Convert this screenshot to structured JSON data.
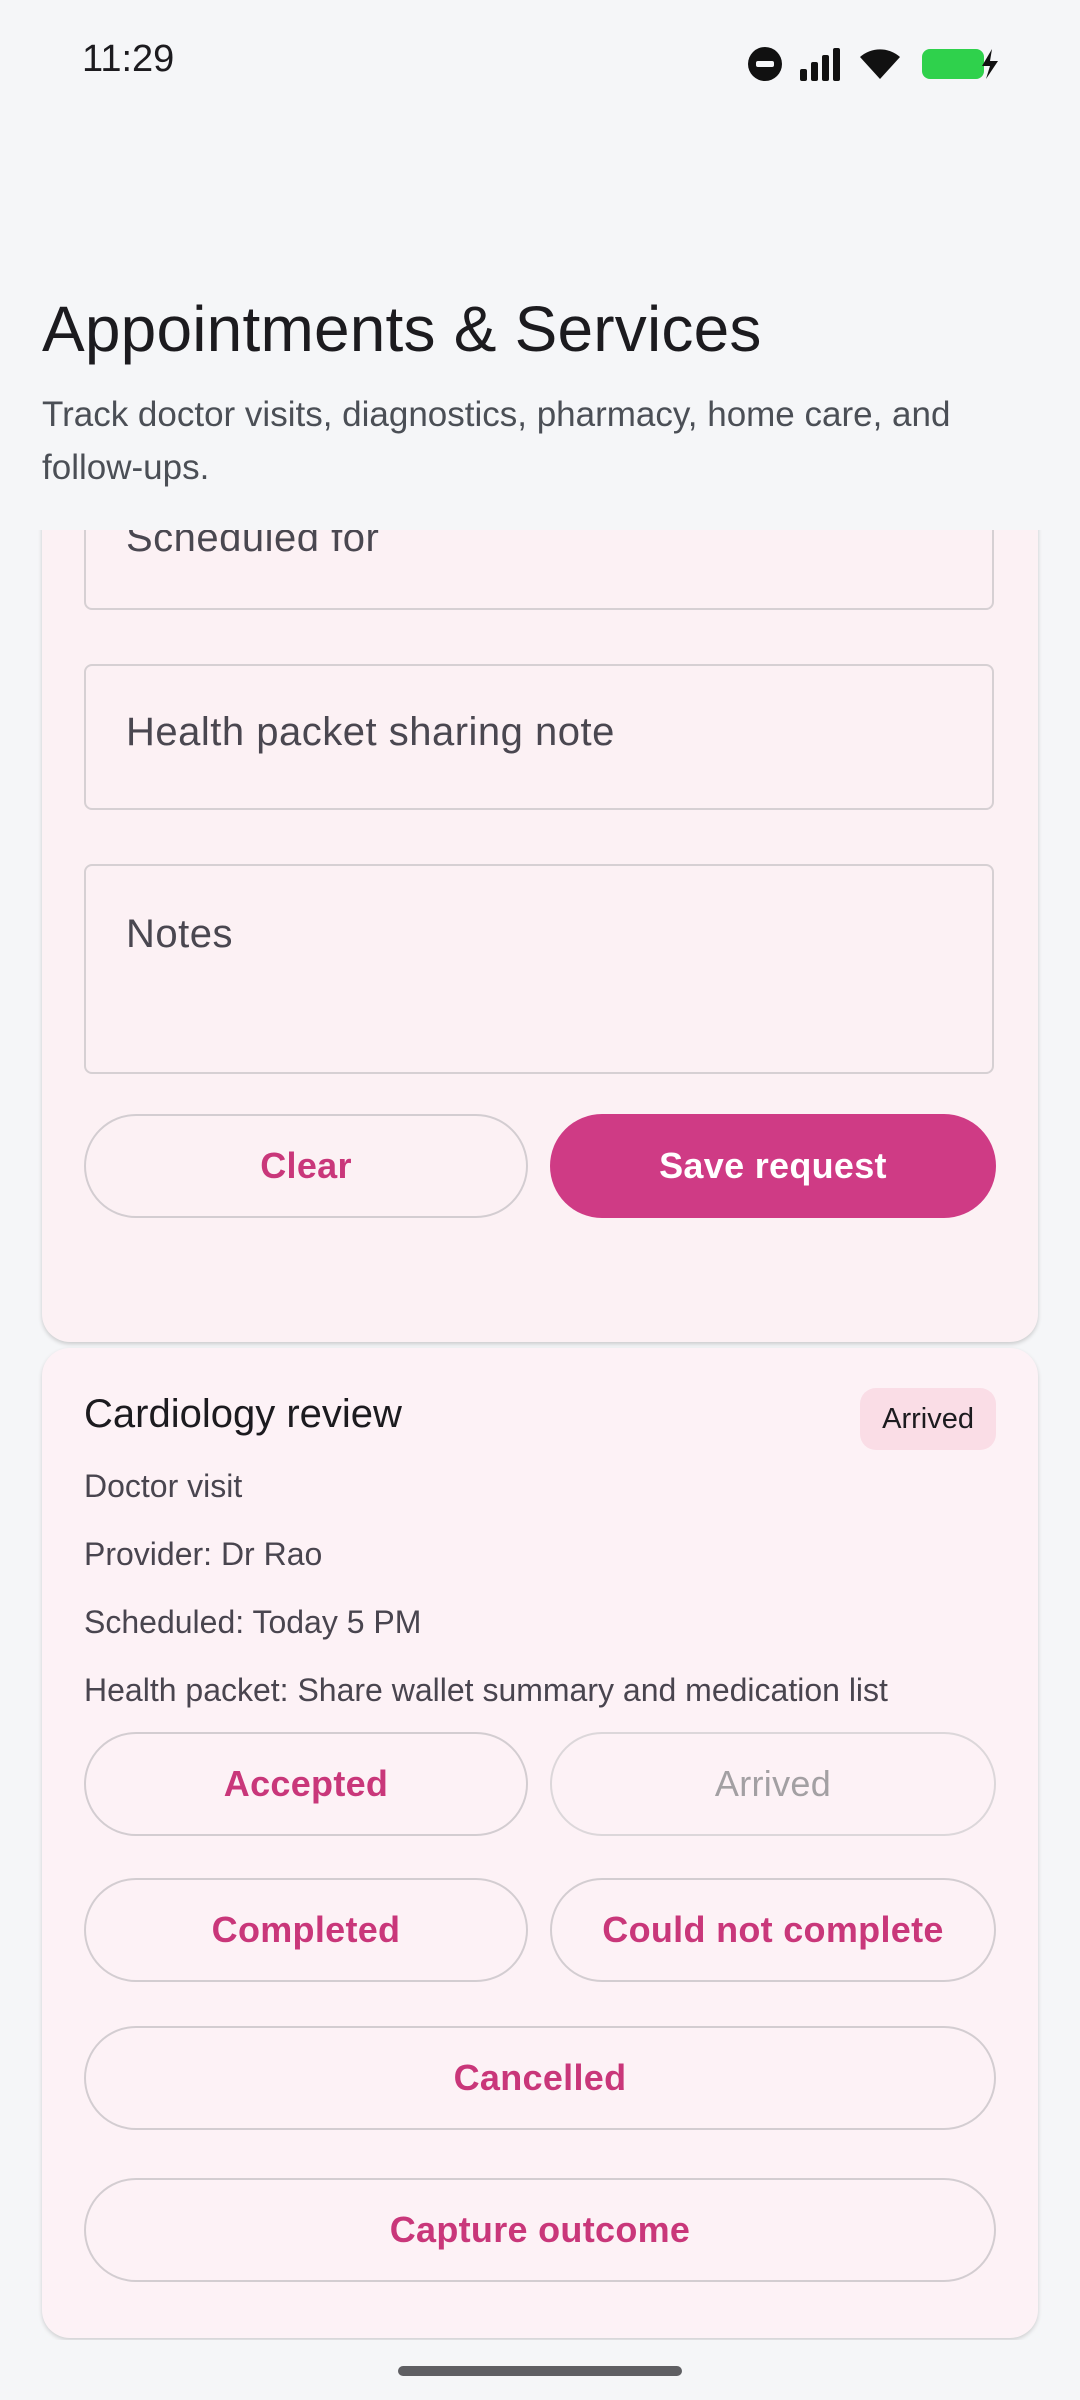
{
  "status_bar": {
    "time": "11:29",
    "icons": [
      "do-not-disturb-icon",
      "signal-icon",
      "wifi-icon",
      "battery-charging-icon"
    ],
    "battery_color": "#2fd14c"
  },
  "header": {
    "title": "Appointments & Services",
    "subtitle": "Track doctor visits, diagnostics, pharmacy, home care, and follow-ups."
  },
  "form": {
    "scheduled_label": "Scheduled for",
    "packet_note_label": "Health packet sharing note",
    "notes_label": "Notes",
    "clear_label": "Clear",
    "save_label": "Save request"
  },
  "request": {
    "title": "Cardiology review",
    "status": "Arrived",
    "type": "Doctor visit",
    "provider": "Provider: Dr Rao",
    "scheduled": "Scheduled: Today 5 PM",
    "health_packet": "Health packet: Share wallet summary and medication list",
    "actions": {
      "accepted": "Accepted",
      "arrived": "Arrived",
      "completed": "Completed",
      "could_not_complete": "Could not complete",
      "cancelled": "Cancelled",
      "capture_outcome": "Capture outcome"
    }
  },
  "colors": {
    "accent": "#cf3b85",
    "card_background": "#fcf1f4",
    "badge_background": "#fadde6"
  }
}
